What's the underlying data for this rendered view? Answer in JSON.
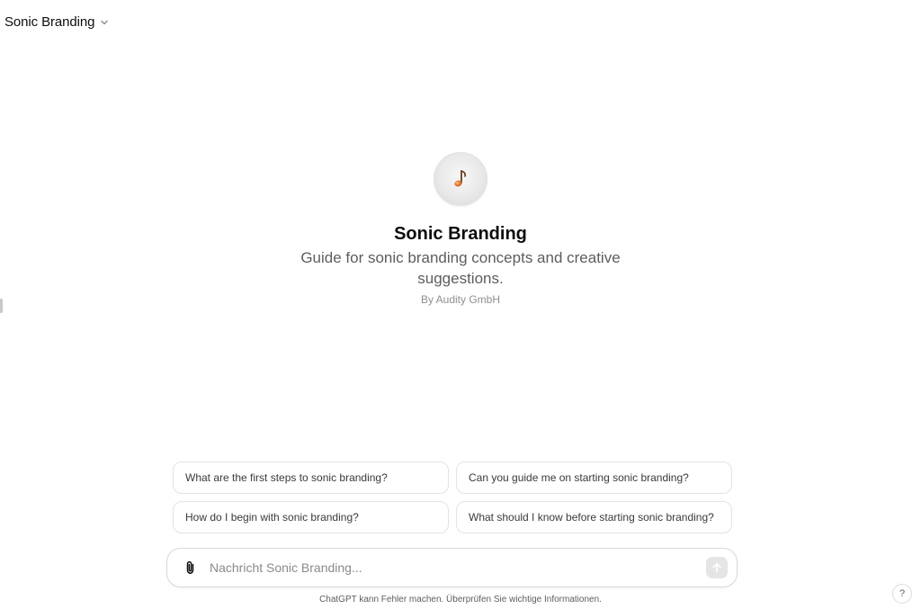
{
  "header": {
    "title": "Sonic Branding"
  },
  "gpt": {
    "name": "Sonic Branding",
    "description": "Guide for sonic branding concepts and creative suggestions.",
    "author": "By Audity GmbH"
  },
  "suggestions": [
    "What are the first steps to sonic branding?",
    "Can you guide me on starting sonic branding?",
    "How do I begin with sonic branding?",
    "What should I know before starting sonic branding?"
  ],
  "composer": {
    "placeholder": "Nachricht Sonic Branding..."
  },
  "footer": {
    "disclaimer": "ChatGPT kann Fehler machen. Überprüfen Sie wichtige Informationen."
  },
  "help": {
    "label": "?"
  },
  "colors": {
    "note_accent": "#e07a2e",
    "send_disabled": "#e5e5e5"
  }
}
